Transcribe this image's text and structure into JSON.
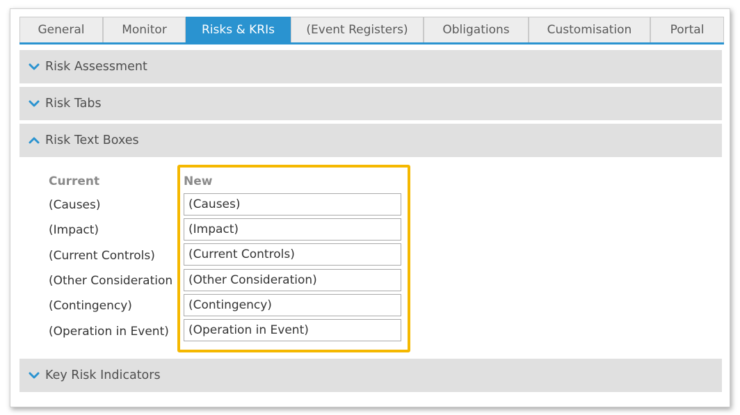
{
  "tabs": [
    {
      "label": "General"
    },
    {
      "label": "Monitor"
    },
    {
      "label": "Risks & KRIs"
    },
    {
      "label": "(Event Registers)"
    },
    {
      "label": "Obligations"
    },
    {
      "label": "Customisation"
    },
    {
      "label": "Portal"
    }
  ],
  "active_tab": "Risks & KRIs",
  "sections": {
    "risk_assessment": {
      "label": "Risk Assessment",
      "state": "collapsed"
    },
    "risk_tabs": {
      "label": "Risk Tabs",
      "state": "collapsed"
    },
    "risk_text_boxes": {
      "label": "Risk Text Boxes",
      "state": "expanded"
    },
    "key_risk_indicators": {
      "label": "Key Risk Indicators",
      "state": "collapsed"
    }
  },
  "text_boxes": {
    "current_header": "Current",
    "new_header": "New",
    "rows": [
      {
        "current": "(Causes)",
        "new": "(Causes)"
      },
      {
        "current": "(Impact)",
        "new": "(Impact)"
      },
      {
        "current": "(Current Controls)",
        "new": "(Current Controls)"
      },
      {
        "current": "(Other Consideration",
        "new": "(Other Consideration)"
      },
      {
        "current": "(Contingency)",
        "new": "(Contingency)"
      },
      {
        "current": "(Operation in Event)",
        "new": "(Operation in Event)"
      }
    ]
  },
  "colors": {
    "accent": "#2a93d0",
    "highlight": "#f5b800",
    "section_bg": "#e0e0e0"
  },
  "icons": {
    "collapsed": "chevron-down-icon",
    "expanded": "chevron-up-icon"
  }
}
